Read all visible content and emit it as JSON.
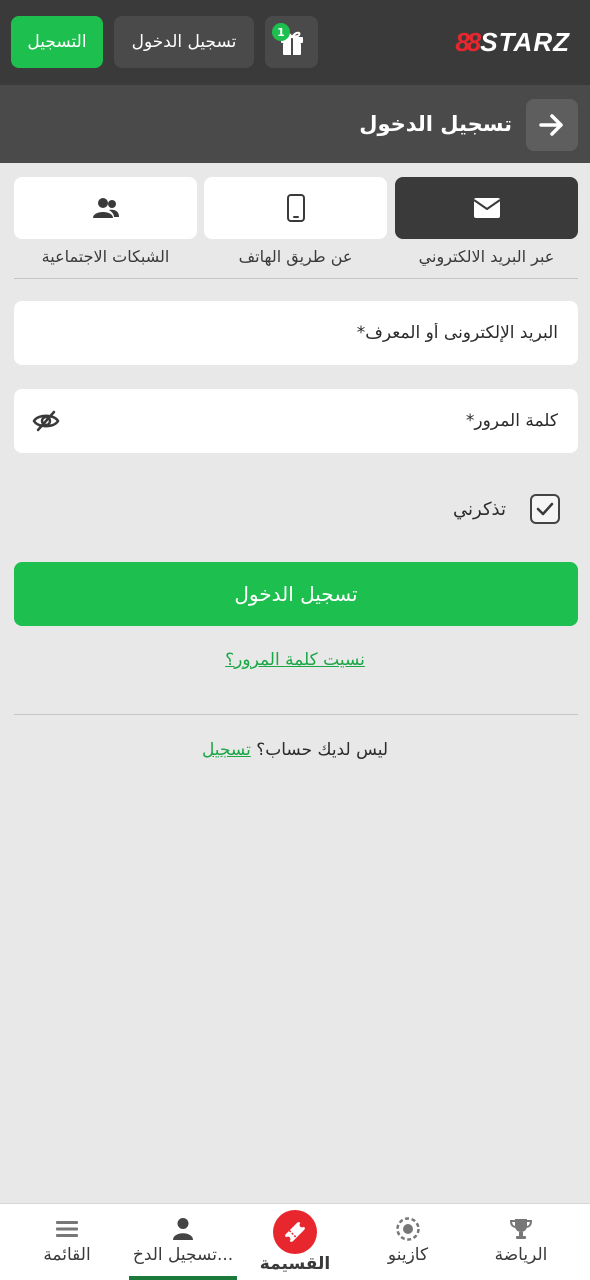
{
  "header": {
    "register_label": "التسجيل",
    "login_label": "تسجيل الدخول",
    "gift_count": "1",
    "logo_mark": "88",
    "logo_text": "STARZ"
  },
  "titlebar": {
    "title": "تسجيل الدخول"
  },
  "tabs": [
    {
      "label": "عبر البريد الالكتروني",
      "icon": "envelope-icon",
      "active": true
    },
    {
      "label": "عن طريق الهاتف",
      "icon": "phone-icon",
      "active": false
    },
    {
      "label": "الشبكات الاجتماعية",
      "icon": "users-icon",
      "active": false
    }
  ],
  "form": {
    "email_placeholder": "البريد الإلكترونى أو المعرف*",
    "password_placeholder": "كلمة المرور*",
    "remember_label": "تذكرني",
    "remember_checked": true,
    "submit_label": "تسجيل الدخول",
    "forgot_label": "نسيت كلمة المرور؟",
    "no_account_text": "ليس لديك حساب؟",
    "register_link": "تسجيل"
  },
  "bottom_nav": [
    {
      "label": "الرياضة",
      "icon": "trophy-icon"
    },
    {
      "label": "كازينو",
      "icon": "casino-chip-icon"
    },
    {
      "label": "القسيمة",
      "icon": "ticket-icon"
    },
    {
      "label": "تسجيل الدخ...",
      "icon": "user-icon",
      "active": true
    },
    {
      "label": "القائمة",
      "icon": "menu-icon"
    }
  ],
  "colors": {
    "accent_green": "#1dbf4e",
    "brand_red": "#e8262d",
    "header_dark": "#3a3a3a"
  }
}
